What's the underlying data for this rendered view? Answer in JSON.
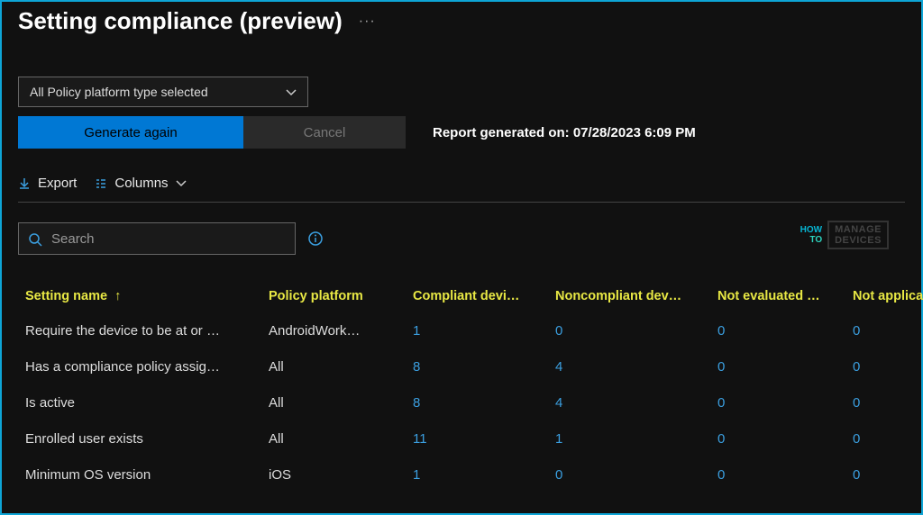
{
  "header": {
    "title": "Setting compliance (preview)",
    "more": "···"
  },
  "filter": {
    "platform_dropdown": "All Policy platform type selected"
  },
  "actions": {
    "generate": "Generate again",
    "cancel": "Cancel",
    "report_label": "Report generated on: 07/28/2023 6:09 PM"
  },
  "toolbar": {
    "export": "Export",
    "columns": "Columns"
  },
  "search": {
    "placeholder": "Search"
  },
  "watermark": {
    "how": "HOW",
    "to": "TO",
    "box1": "MANAGE",
    "box2": "DEVICES"
  },
  "table": {
    "columns": [
      "Setting name",
      "Policy platform",
      "Compliant devi…",
      "Noncompliant dev…",
      "Not evaluated …",
      "Not applicable…"
    ],
    "sort_indicator": "↑",
    "rows": [
      {
        "name": "Require the device to be at or …",
        "platform": "AndroidWork…",
        "compliant": "1",
        "noncompliant": "0",
        "notevaluated": "0",
        "notapplicable": "0"
      },
      {
        "name": "Has a compliance policy assig…",
        "platform": "All",
        "compliant": "8",
        "noncompliant": "4",
        "notevaluated": "0",
        "notapplicable": "0"
      },
      {
        "name": "Is active",
        "platform": "All",
        "compliant": "8",
        "noncompliant": "4",
        "notevaluated": "0",
        "notapplicable": "0"
      },
      {
        "name": "Enrolled user exists",
        "platform": "All",
        "compliant": "11",
        "noncompliant": "1",
        "notevaluated": "0",
        "notapplicable": "0"
      },
      {
        "name": "Minimum OS version",
        "platform": "iOS",
        "compliant": "1",
        "noncompliant": "0",
        "notevaluated": "0",
        "notapplicable": "0"
      }
    ]
  }
}
